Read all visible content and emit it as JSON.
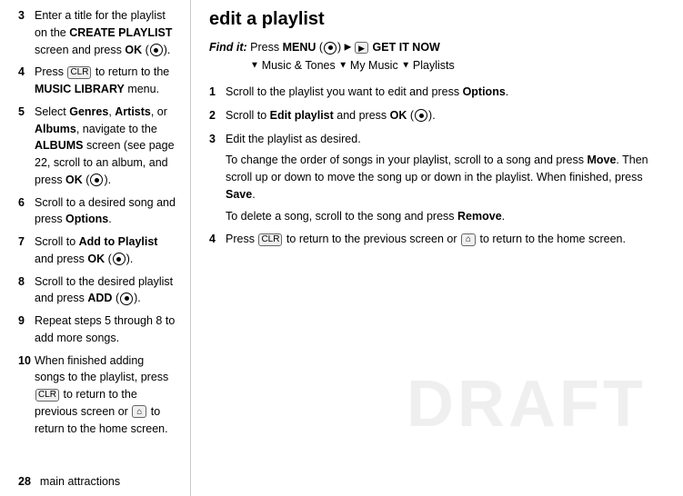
{
  "left": {
    "items": [
      {
        "num": "3",
        "text_parts": [
          {
            "type": "normal",
            "text": "Enter a title for the playlist on the "
          },
          {
            "type": "bold",
            "text": "CREATE PLAYLIST"
          },
          {
            "type": "normal",
            "text": " screen and press "
          },
          {
            "type": "bold",
            "text": "OK"
          },
          {
            "type": "normal",
            "text": " ("
          },
          {
            "type": "circle",
            "text": ""
          },
          {
            "type": "normal",
            "text": ")."
          }
        ]
      },
      {
        "num": "4",
        "text_parts": [
          {
            "type": "normal",
            "text": "Press "
          },
          {
            "type": "icon",
            "text": "CLR"
          },
          {
            "type": "normal",
            "text": " to return to the "
          },
          {
            "type": "bold",
            "text": "MUSIC LIBRARY"
          },
          {
            "type": "normal",
            "text": " menu."
          }
        ]
      },
      {
        "num": "5",
        "text_parts": [
          {
            "type": "normal",
            "text": "Select "
          },
          {
            "type": "bold",
            "text": "Genres"
          },
          {
            "type": "normal",
            "text": ", "
          },
          {
            "type": "bold",
            "text": "Artists"
          },
          {
            "type": "normal",
            "text": ", or "
          },
          {
            "type": "bold",
            "text": "Albums"
          },
          {
            "type": "normal",
            "text": ", navigate to the "
          },
          {
            "type": "bold",
            "text": "ALBUMS"
          },
          {
            "type": "normal",
            "text": " screen (see page 22, scroll to an album, and press "
          },
          {
            "type": "bold",
            "text": "OK"
          },
          {
            "type": "normal",
            "text": " ("
          },
          {
            "type": "circle",
            "text": ""
          },
          {
            "type": "normal",
            "text": ")."
          }
        ]
      },
      {
        "num": "6",
        "text_parts": [
          {
            "type": "normal",
            "text": "Scroll to a desired song and press "
          },
          {
            "type": "bold",
            "text": "Options"
          },
          {
            "type": "normal",
            "text": "."
          }
        ]
      },
      {
        "num": "7",
        "text_parts": [
          {
            "type": "normal",
            "text": "Scroll to "
          },
          {
            "type": "bold",
            "text": "Add to Playlist"
          },
          {
            "type": "normal",
            "text": " and press "
          },
          {
            "type": "bold",
            "text": "OK"
          },
          {
            "type": "normal",
            "text": " ("
          },
          {
            "type": "circle",
            "text": ""
          },
          {
            "type": "normal",
            "text": ")."
          }
        ]
      },
      {
        "num": "8",
        "text_parts": [
          {
            "type": "normal",
            "text": "Scroll to the desired playlist and press "
          },
          {
            "type": "bold",
            "text": "ADD"
          },
          {
            "type": "normal",
            "text": " ("
          },
          {
            "type": "circle",
            "text": ""
          },
          {
            "type": "normal",
            "text": ")."
          }
        ]
      },
      {
        "num": "9",
        "text_parts": [
          {
            "type": "normal",
            "text": "Repeat steps 5 through 8 to add more songs."
          }
        ]
      },
      {
        "num": "10",
        "text_parts": [
          {
            "type": "normal",
            "text": "When finished adding songs to the playlist, press "
          },
          {
            "type": "icon",
            "text": "CLR"
          },
          {
            "type": "normal",
            "text": " to return to the previous screen or "
          },
          {
            "type": "icon",
            "text": "⌂"
          },
          {
            "type": "normal",
            "text": " to return to the home screen."
          }
        ]
      }
    ],
    "footer_page": "28",
    "footer_label": "main attractions"
  },
  "right": {
    "title": "edit a playlist",
    "find_it": {
      "label": "Find it:",
      "press": "Press",
      "menu": "MENU",
      "arrow": "▶",
      "get_icon": "GET IT NOW",
      "down_arrow": "▼",
      "nav1": "Music & Tones",
      "down_arrow2": "▼",
      "nav2": "My Music",
      "down_arrow3": "▼",
      "nav3": "Playlists"
    },
    "steps": [
      {
        "num": "1",
        "text": "Scroll to the playlist you want to edit and press Options."
      },
      {
        "num": "2",
        "text": "Scroll to Edit playlist and press OK (●).",
        "bold_parts": [
          "Edit playlist",
          "OK"
        ]
      },
      {
        "num": "3",
        "text": "Edit the playlist as desired.",
        "sub1": "To change the order of songs in your playlist, scroll to a song and press Move. Then scroll up or down to move the song up or down in the playlist. When finished, press Save.",
        "sub2": "To delete a song, scroll to the song and press Remove."
      },
      {
        "num": "4",
        "text": "Press CLR to return to the previous screen or ⌂ to return to the home screen."
      }
    ]
  }
}
